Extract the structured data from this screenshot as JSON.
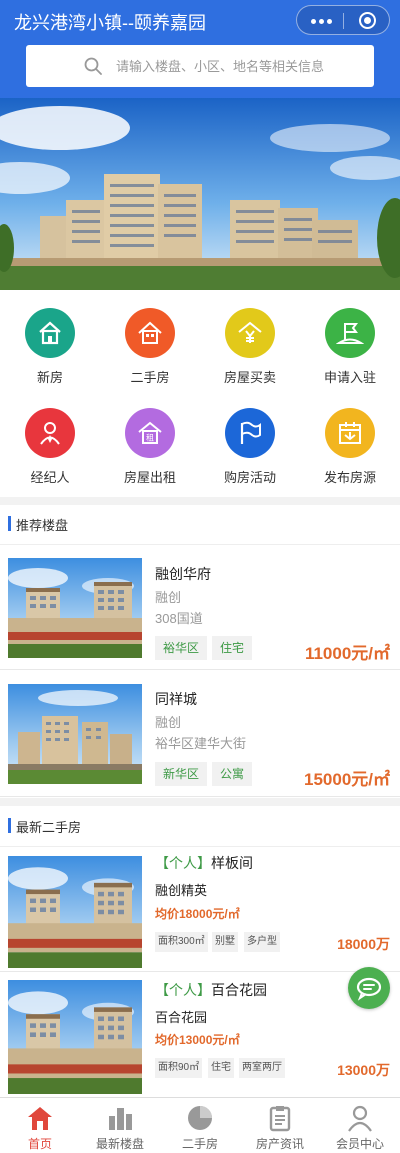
{
  "header": {
    "title": "龙兴港湾小镇--颐养嘉园",
    "search_placeholder": "请输入楼盘、小区、地名等相关信息",
    "icons": [
      "more-icon",
      "target-icon",
      "search-icon"
    ]
  },
  "nav": {
    "items": [
      {
        "label": "新房",
        "icon": "house-icon",
        "color": "#1aa58a"
      },
      {
        "label": "二手房",
        "icon": "house-outline-icon",
        "color": "#f05a28"
      },
      {
        "label": "房屋买卖",
        "icon": "yuan-house-icon",
        "color": "#e2c91a"
      },
      {
        "label": "申请入驻",
        "icon": "flag-icon",
        "color": "#3cb346"
      },
      {
        "label": "经纪人",
        "icon": "person-icon",
        "color": "#e8363d"
      },
      {
        "label": "房屋出租",
        "icon": "rent-icon",
        "color": "#b36be0"
      },
      {
        "label": "购房活动",
        "icon": "flag-outline-icon",
        "color": "#1c67d8"
      },
      {
        "label": "发布房源",
        "icon": "post-icon",
        "color": "#f2b51f"
      }
    ]
  },
  "recommend": {
    "title": "推荐楼盘",
    "items": [
      {
        "name": "融创华府",
        "developer": "融创",
        "address": "308国道",
        "tags": [
          "裕华区",
          "住宅"
        ],
        "price": "11000元/㎡"
      },
      {
        "name": "同祥城",
        "developer": "融创",
        "address": "裕华区建华大街",
        "tags": [
          "新华区",
          "公寓"
        ],
        "price": "15000元/㎡"
      }
    ]
  },
  "secondhand": {
    "title": "最新二手房",
    "items": [
      {
        "badge": "【个人】",
        "name": "样板间",
        "community": "融创精英",
        "avg": "均价18000元/㎡",
        "tags": [
          "面积300㎡",
          "别墅",
          "多户型"
        ],
        "price": "18000万"
      },
      {
        "badge": "【个人】",
        "name": "百合花园",
        "community": "百合花园",
        "avg": "均价13000元/㎡",
        "tags": [
          "面积90㎡",
          "住宅",
          "两室两厅"
        ],
        "price": "13000万"
      }
    ]
  },
  "tabbar": {
    "items": [
      {
        "label": "首页",
        "icon": "home-icon",
        "active": true
      },
      {
        "label": "最新楼盘",
        "icon": "buildings-icon",
        "active": false
      },
      {
        "label": "二手房",
        "icon": "pie-icon",
        "active": false
      },
      {
        "label": "房产资讯",
        "icon": "clipboard-icon",
        "active": false
      },
      {
        "label": "会员中心",
        "icon": "user-icon",
        "active": false
      }
    ]
  },
  "colors": {
    "brand": "#2f6fe0",
    "price": "#e2692c",
    "tag_text": "#3e9a46",
    "tab_active": "#e0473c",
    "chat": "#4caf50"
  }
}
